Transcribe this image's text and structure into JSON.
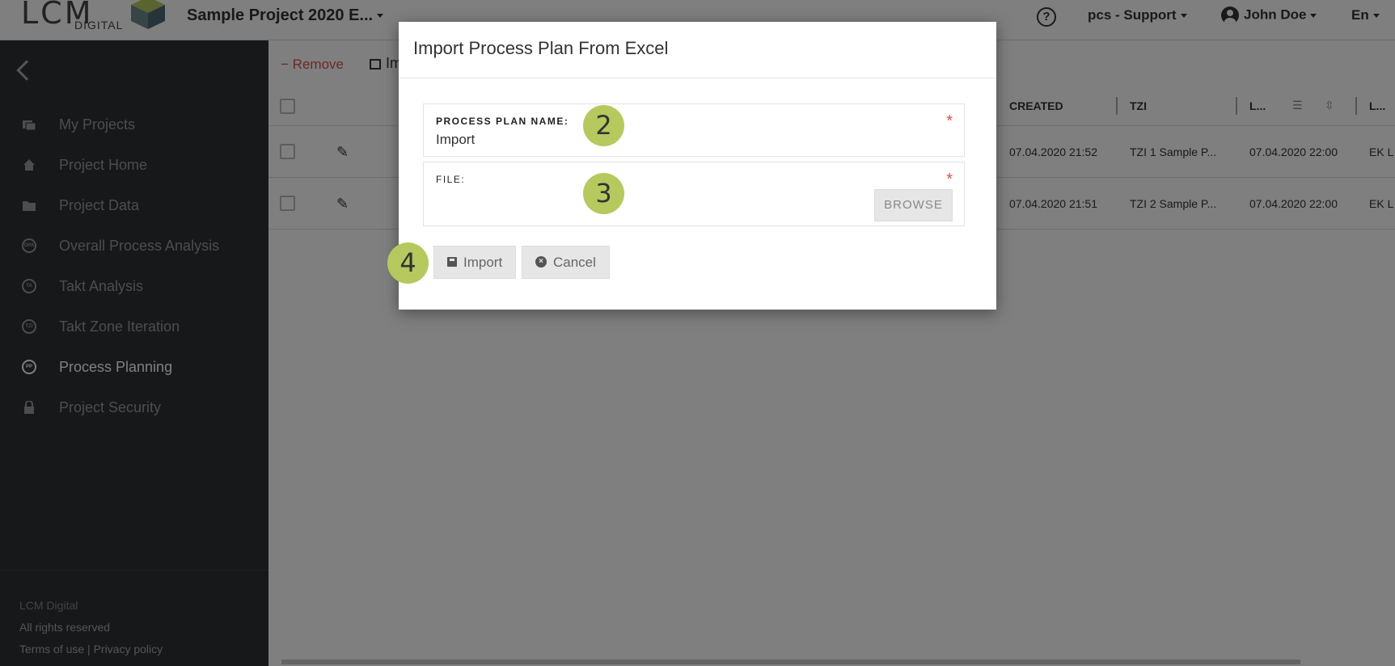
{
  "header": {
    "logo_text": "LCM",
    "logo_sub": "DIGITAL",
    "project_title": "Sample Project 2020 E...",
    "help": "?",
    "support": "pcs - Support",
    "user": "John Doe",
    "language": "En"
  },
  "sidebar": {
    "items": [
      {
        "label": "My Projects",
        "icon": "folders-icon"
      },
      {
        "label": "Project Home",
        "icon": "home-icon"
      },
      {
        "label": "Project Data",
        "icon": "folder-icon"
      },
      {
        "label": "Overall Process Analysis",
        "icon": "opa-icon",
        "abbr": "OPA"
      },
      {
        "label": "Takt Analysis",
        "icon": "ta-icon",
        "abbr": "TA"
      },
      {
        "label": "Takt Zone Iteration",
        "icon": "tzi-icon",
        "abbr": "TZI"
      },
      {
        "label": "Process Planning",
        "icon": "pp-icon",
        "abbr": "PP",
        "active": true
      },
      {
        "label": "Project Security",
        "icon": "lock-icon"
      }
    ],
    "footer": {
      "company": "LCM Digital",
      "rights": "All rights reserved",
      "terms": "Terms of use",
      "separator": "|",
      "privacy": "Privacy policy"
    }
  },
  "toolbar": {
    "remove": "Remove",
    "import_partial": "Im"
  },
  "table": {
    "headers": [
      "CREATED",
      "TZI",
      "L...",
      "L..."
    ],
    "rows": [
      {
        "created": "07.04.2020 21:52",
        "tzi": "TZI 1 Sample P...",
        "last": "07.04.2020 22:00",
        "extra": "EK L"
      },
      {
        "created": "07.04.2020 21:51",
        "tzi": "TZI 2 Sample P...",
        "last": "07.04.2020 22:00",
        "extra": "EK L"
      }
    ]
  },
  "modal": {
    "title": "Import Process Plan From Excel",
    "name_label": "PROCESS PLAN NAME:",
    "name_value": "Import",
    "file_label": "FILE:",
    "required_mark": "*",
    "browse": "BROWSE",
    "import_button": "Import",
    "cancel_button": "Cancel"
  },
  "markers": [
    "2",
    "3",
    "4"
  ],
  "colors": {
    "sidebar_bg": "#2c3033",
    "marker": "#b5c95e",
    "danger": "#d9534f",
    "overlay": "rgba(0,0,0,0.5)"
  }
}
